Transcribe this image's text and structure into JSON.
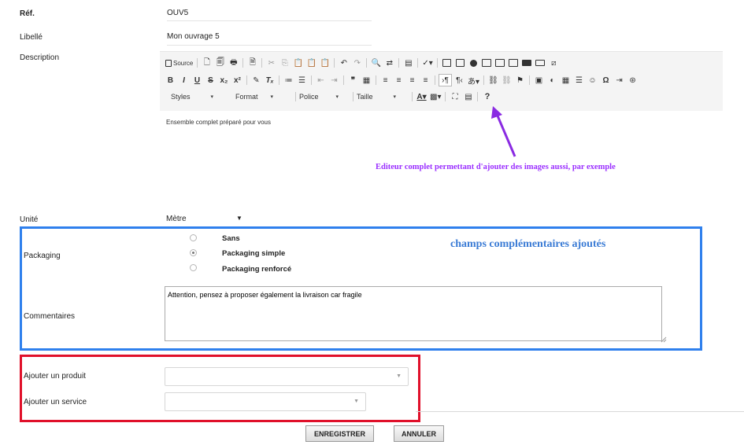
{
  "form": {
    "ref_label": "Réf.",
    "ref_value": "OUV5",
    "libelle_label": "Libellé",
    "libelle_value": "Mon ouvrage 5",
    "description_label": "Description",
    "description_content": "Ensemble complet préparé pour vous",
    "unite_label": "Unité",
    "unite_value": "Mètre",
    "packaging_label": "Packaging",
    "packaging_options": [
      "Sans",
      "Packaging simple",
      "Packaging renforcé"
    ],
    "packaging_selected": "Packaging simple",
    "commentaires_label": "Commentaires",
    "commentaires_value": "Attention, pensez à proposer également la livraison car fragile",
    "ajouter_produit_label": "Ajouter un produit",
    "ajouter_service_label": "Ajouter un service"
  },
  "editor": {
    "source_label": "Source",
    "styles_label": "Styles",
    "format_label": "Format",
    "police_label": "Police",
    "taille_label": "Taille",
    "help_label": "?"
  },
  "annotations": {
    "editor_note": "Editeur complet permettant d'ajouter des images aussi, par exemple",
    "fields_note": "champs complémentaires ajoutés",
    "arrow_color": "#8a2be2",
    "blue_box_color": "#2f80ed",
    "red_box_color": "#e0102a"
  },
  "actions": {
    "save_label": "ENREGISTRER",
    "cancel_label": "ANNULER"
  }
}
